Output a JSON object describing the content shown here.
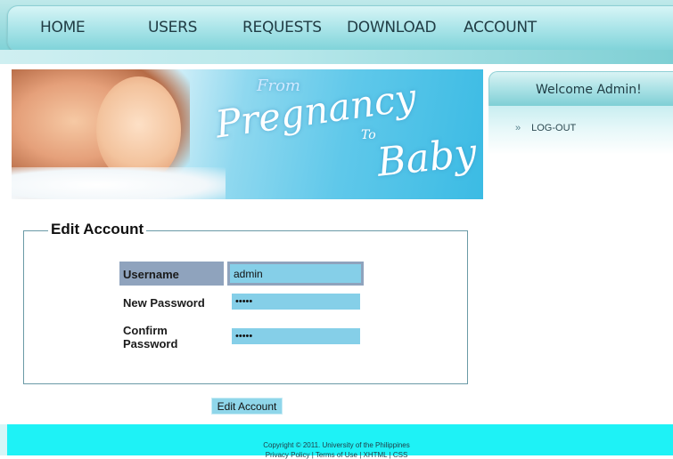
{
  "nav": {
    "home": "HOME",
    "users": "USERS",
    "requests": "REQUESTS",
    "download": "DOWNLOAD",
    "account": "ACCOUNT"
  },
  "banner": {
    "from": "From",
    "pregnancy": "Pregnancy",
    "to": "To",
    "baby": "Baby"
  },
  "sidebar": {
    "welcome": "Welcome Admin!",
    "bullet": "»",
    "logout": "LOG-OUT"
  },
  "form": {
    "legend": "Edit Account",
    "username_label": "Username",
    "username_value": "admin",
    "new_password_label": "New Password",
    "new_password_value": "•••••",
    "confirm_password_label_1": "Confirm",
    "confirm_password_label_2": "Password",
    "confirm_password_value": "•••••",
    "submit": "Edit Account"
  },
  "footer": {
    "line1": "Copyright © 2011. University of the Philippines",
    "line2": "Privacy Policy | Terms of Use | XHTML | CSS"
  },
  "colors": {
    "nav_bar": "#aee6ea",
    "label_highlight": "#8fa3bd",
    "input_bg": "#85cfe8",
    "footer_bg": "#1ef2f6"
  }
}
